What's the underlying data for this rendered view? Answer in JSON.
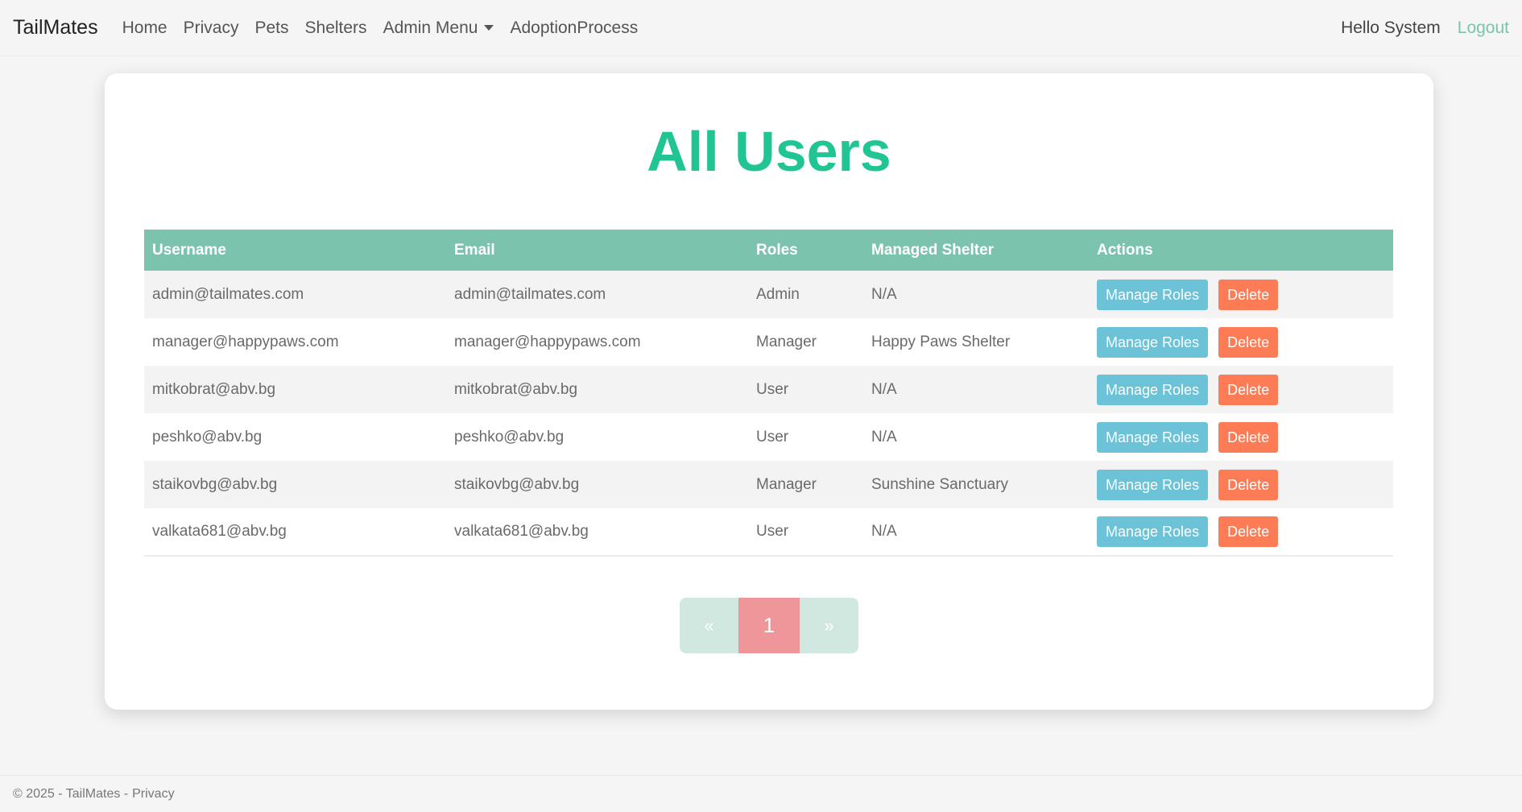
{
  "navbar": {
    "brand": "TailMates",
    "links": [
      "Home",
      "Privacy",
      "Pets",
      "Shelters",
      "Admin Menu",
      "AdoptionProcess"
    ],
    "greeting": "Hello System",
    "logout": "Logout"
  },
  "page": {
    "title": "All Users"
  },
  "table": {
    "headers": [
      "Username",
      "Email",
      "Roles",
      "Managed Shelter",
      "Actions"
    ],
    "rows": [
      [
        "admin@tailmates.com",
        "admin@tailmates.com",
        "Admin",
        "N/A"
      ],
      [
        "manager@happypaws.com",
        "manager@happypaws.com",
        "Manager",
        "Happy Paws Shelter"
      ],
      [
        "mitkobrat@abv.bg",
        "mitkobrat@abv.bg",
        "User",
        "N/A"
      ],
      [
        "peshko@abv.bg",
        "peshko@abv.bg",
        "User",
        "N/A"
      ],
      [
        "staikovbg@abv.bg",
        "staikovbg@abv.bg",
        "Manager",
        "Sunshine Sanctuary"
      ],
      [
        "valkata681@abv.bg",
        "valkata681@abv.bg",
        "User",
        "N/A"
      ]
    ],
    "manage_label": "Manage Roles",
    "delete_label": "Delete"
  },
  "pagination": {
    "prev": "«",
    "current": "1",
    "next": "»"
  },
  "footer": {
    "text": "© 2025 - TailMates -",
    "link": "Privacy"
  },
  "colors": {
    "title": "#20c593",
    "header": "#7bc3ad",
    "manage_button": "#6cc2d6",
    "delete_button": "#fd7b55",
    "page_current": "#ef969a",
    "page_other": "#d0e8e0"
  }
}
